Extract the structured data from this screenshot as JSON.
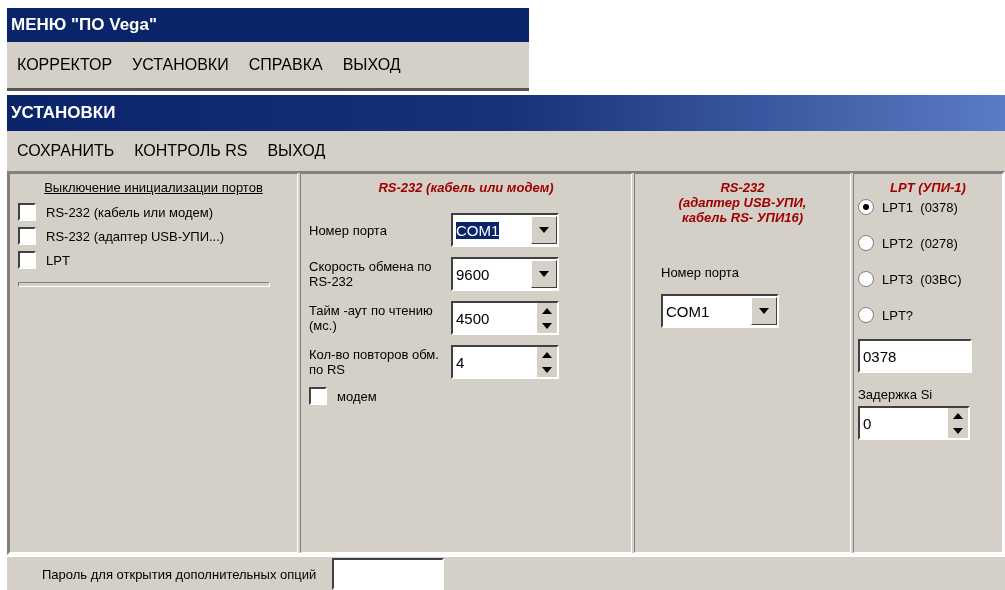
{
  "menu_window": {
    "title": "МЕНЮ \"ПО Vega\"",
    "menu": [
      "КОРРЕКТОР",
      "УСТАНОВКИ",
      "СПРАВКА",
      "ВЫХОД"
    ]
  },
  "settings_window": {
    "title": "УСТАНОВКИ",
    "menu": [
      "СОХРАНИТЬ",
      "КОНТРОЛЬ RS",
      "ВЫХОД"
    ],
    "init_panel": {
      "heading": "Выключение инициализации портов",
      "checkboxes": [
        {
          "label": "RS-232 (кабель или модем)",
          "checked": false
        },
        {
          "label": "RS-232 (адаптер USB-УПИ...)",
          "checked": false
        },
        {
          "label": "LPT",
          "checked": false
        }
      ]
    },
    "rs232_panel": {
      "heading": "RS-232 (кабель или модем)",
      "fields": [
        {
          "kind": "combo",
          "label": "Номер порта",
          "value": "COM1",
          "text_selected": true
        },
        {
          "kind": "combo",
          "label": "Скорость обмена по RS-232",
          "value": "9600",
          "text_selected": false
        },
        {
          "kind": "spin",
          "label": "Тайм -аут по чтению (мс.)",
          "value": "4500"
        },
        {
          "kind": "spin",
          "label": "Кол-во повторов обм. по RS",
          "value": "4"
        }
      ],
      "modem": {
        "label": "модем",
        "checked": false
      }
    },
    "usb_panel": {
      "heading_lines": [
        "RS-232",
        "(адаптер USB-УПИ,",
        "кабель RS- УПИ16)"
      ],
      "label": "Номер порта",
      "value": "COM1"
    },
    "lpt_panel": {
      "heading": "LPT (УПИ-1)",
      "radios": [
        {
          "label": "LPT1",
          "port": "(0378)",
          "selected": true
        },
        {
          "label": "LPT2",
          "port": "(0278)",
          "selected": false
        },
        {
          "label": "LPT3",
          "port": "(03BC)",
          "selected": false
        },
        {
          "label": "LPT?",
          "selected": false
        }
      ],
      "address": "0378",
      "delay_label": "Задержка Si",
      "delay_value": "0"
    },
    "password": {
      "label": "Пароль для открытия дополнительных опций"
    }
  }
}
